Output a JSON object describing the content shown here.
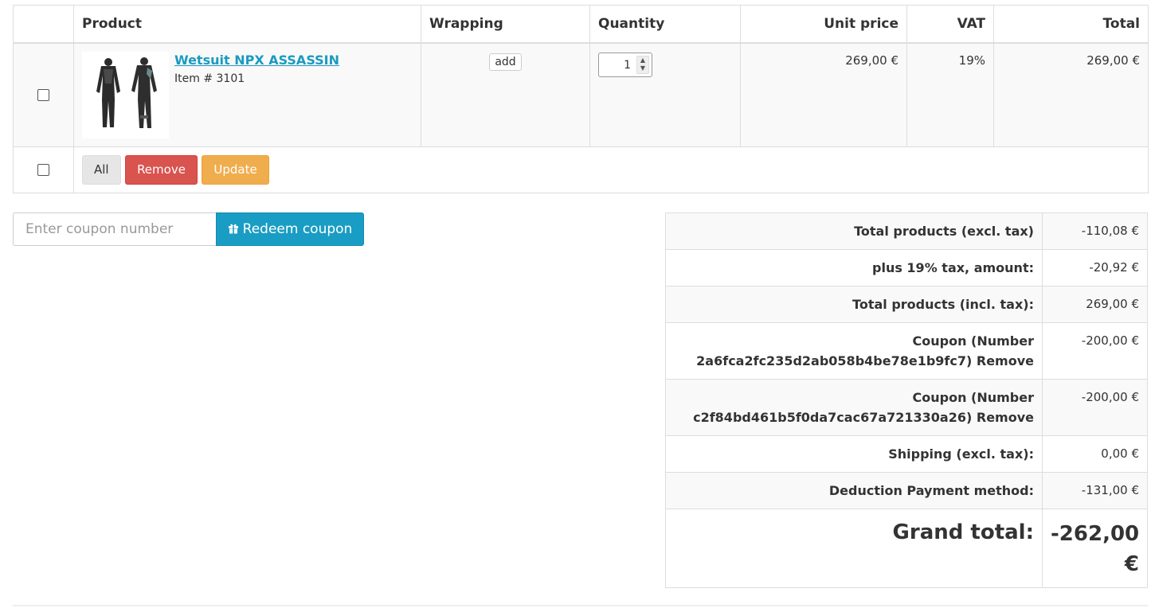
{
  "cart": {
    "headers": {
      "product": "Product",
      "wrapping": "Wrapping",
      "quantity": "Quantity",
      "unit_price": "Unit price",
      "vat": "VAT",
      "total": "Total"
    },
    "items": [
      {
        "name": "Wetsuit NPX ASSASSIN",
        "sku": "Item # 3101",
        "wrapping_label": "add",
        "quantity": "1",
        "unit_price": "269,00 €",
        "vat": "19%",
        "total": "269,00 €"
      }
    ],
    "actions": {
      "all_label": "All",
      "remove_label": "Remove",
      "update_label": "Update"
    }
  },
  "coupon": {
    "placeholder": "Enter coupon number",
    "button_label": "Redeem coupon"
  },
  "totals": {
    "rows": [
      {
        "label": "Total products (excl. tax)",
        "value": "-110,08 €"
      },
      {
        "label": "plus 19% tax, amount:",
        "value": "-20,92 €"
      },
      {
        "label": "Total products (incl. tax):",
        "value": "269,00 €"
      },
      {
        "label": "Coupon (Number 2a6fca2fc235d2ab058b4be78e1b9fc7) Remove",
        "value": "-200,00 €"
      },
      {
        "label": "Coupon (Number c2f84bd461b5f0da7cac67a721330a26) Remove",
        "value": "-200,00 €"
      },
      {
        "label": "Shipping (excl. tax):",
        "value": "0,00 €"
      },
      {
        "label": "Deduction Payment method:",
        "value": "-131,00 €"
      }
    ],
    "grand_label": "Grand total:",
    "grand_value": "-262,00 €"
  },
  "colors": {
    "link": "#1a9bc0",
    "remove": "#d9534f",
    "update": "#f0ad4e",
    "coupon_button": "#1a9dc4"
  }
}
